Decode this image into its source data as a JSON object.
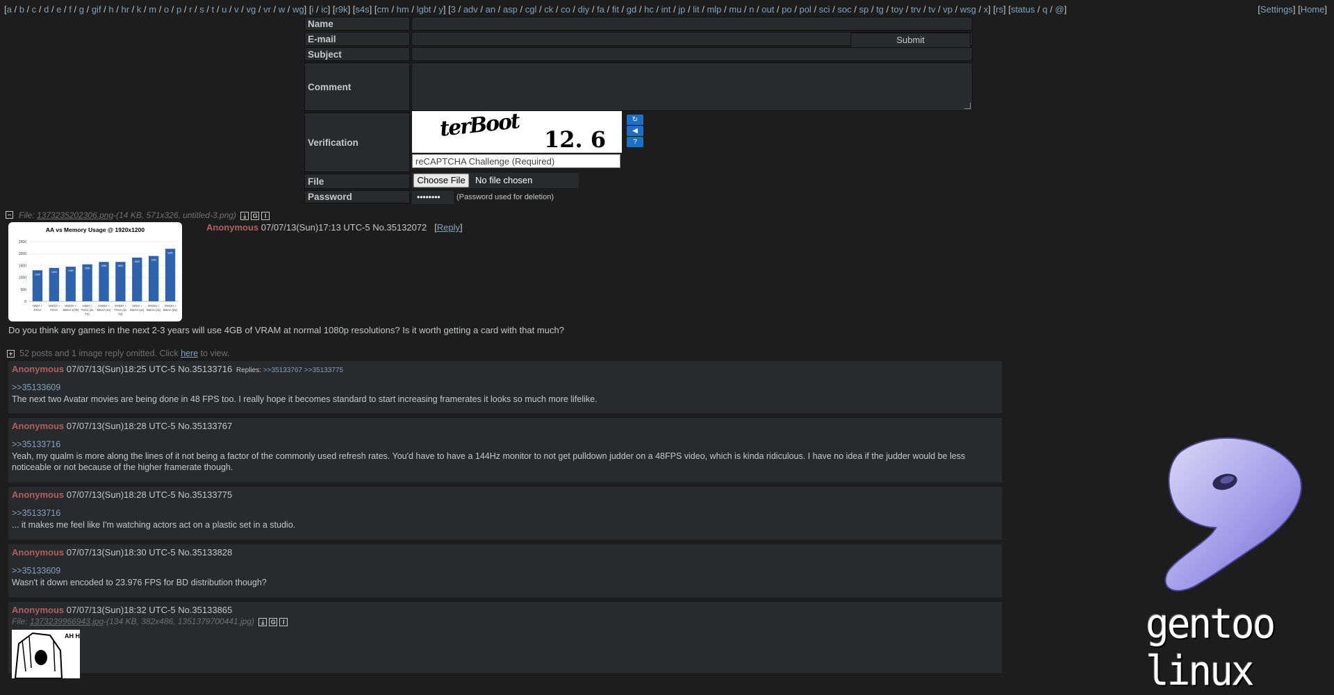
{
  "nav": {
    "group1": [
      "a",
      "b",
      "c",
      "d",
      "e",
      "f",
      "g",
      "gif",
      "h",
      "hr",
      "k",
      "m",
      "o",
      "p",
      "r",
      "s",
      "t",
      "u",
      "v",
      "vg",
      "vr",
      "w",
      "wg"
    ],
    "group2": [
      "i",
      "ic"
    ],
    "group3": [
      "r9k"
    ],
    "group4": [
      "s4s"
    ],
    "group5": [
      "cm",
      "hm",
      "lgbt",
      "y"
    ],
    "group6": [
      "3",
      "adv",
      "an",
      "asp",
      "cgl",
      "ck",
      "co",
      "diy",
      "fa",
      "fit",
      "gd",
      "hc",
      "int",
      "jp",
      "lit",
      "mlp",
      "mu",
      "n",
      "out",
      "po",
      "pol",
      "sci",
      "soc",
      "sp",
      "tg",
      "toy",
      "trv",
      "tv",
      "vp",
      "wsg",
      "x"
    ],
    "group7": [
      "rs"
    ],
    "group8": [
      "status",
      "q",
      "@"
    ],
    "settings": "Settings",
    "home": "Home"
  },
  "form": {
    "name_label": "Name",
    "email_label": "E-mail",
    "subject_label": "Subject",
    "submit_label": "Submit",
    "comment_label": "Comment",
    "verification_label": "Verification",
    "captcha_word1": "terBoot",
    "captcha_word2": "12. 6",
    "captcha_placeholder": "reCAPTCHA Challenge (Required)",
    "file_label": "File",
    "choose_file": "Choose File",
    "no_file": "No file chosen",
    "password_label": "Password",
    "password_value": "••••••••",
    "password_note": "(Password used for deletion)"
  },
  "op": {
    "file_prefix": "File: ",
    "file_name": "1373235202306.png",
    "file_meta": "-(14 KB, 571x326, untitled-3.png)",
    "name": "Anonymous",
    "datetime": "07/07/13(Sun)17:13 UTC-5",
    "post_no": "No.35132072",
    "reply_link": "Reply",
    "comment": "Do you think any games in the next 2-3 years will use 4GB of VRAM at normal 1080p resolutions? Is it worth getting a card with that much?"
  },
  "omitted": {
    "text_before": "52 posts and 1 image reply omitted. Click ",
    "link": "here",
    "text_after": " to view."
  },
  "replies": [
    {
      "name": "Anonymous",
      "datetime": "07/07/13(Sun)18:25 UTC-5",
      "no": "No.35133716",
      "replies_label": "Replies:",
      "reply_links": ">>35133767 >>35133775",
      "quote": ">>35133609",
      "text": "The next two Avatar movies are being done in 48 FPS too. I really hope it becomes standard to start increasing framerates it looks so much more lifelike."
    },
    {
      "name": "Anonymous",
      "datetime": "07/07/13(Sun)18:28 UTC-5",
      "no": "No.35133767",
      "quote": ">>35133716",
      "text": "Yeah, my qualm is more along the lines of it not being a factor of the commonly used refresh rates. You'd have to have a 144Hz monitor to not get pulldown judder on a 48FPS video, which is kinda ridiculous. I have no idea if the judder would be less noticeable or not because of the higher framerate though."
    },
    {
      "name": "Anonymous",
      "datetime": "07/07/13(Sun)18:28 UTC-5",
      "no": "No.35133775",
      "quote": ">>35133716",
      "text": "... it makes me feel like I'm watching actors act on a plastic set in a studio."
    },
    {
      "name": "Anonymous",
      "datetime": "07/07/13(Sun)18:30 UTC-5",
      "no": "No.35133828",
      "quote": ">>35133609",
      "text": "Wasn't it down encoded to 23.976 FPS for BD distribution though?"
    },
    {
      "name": "Anonymous",
      "datetime": "07/07/13(Sun)18:32 UTC-5",
      "no": "No.35133865",
      "file_prefix": "File: ",
      "file_name": "1373239966943.jpg",
      "file_meta": "-(134 KB, 382x486, 1351379700441.jpg)",
      "manga_text": "AH HA HA HA HA"
    }
  ],
  "chart_thumb": {
    "title": "AA vs Memory Usage @ 1920x1200",
    "yticks": [
      "2500",
      "2000",
      "1500",
      "1000",
      "500",
      "0"
    ],
    "categories": [
      "HIGH + FXAA",
      "VHIGH + FXAA",
      "VHIGH + SMAA 1(T6)",
      "HIGH + TXAA (2x T2)",
      "VHIGH + MSAA (2x)",
      "VHIGH + TXAA (2x T2)",
      "HIGH + MSAA (4x)",
      "VHIGH + MSAA (4x)",
      "VHIGH + MSAA (8x)"
    ],
    "values": [
      1300,
      1400,
      1450,
      1550,
      1650,
      1650,
      1830,
      1900,
      2200
    ],
    "bar_labels": [
      "1300",
      "1400",
      "1450",
      "1550",
      "1650",
      "1650",
      "1830",
      "1900",
      "2200"
    ],
    "ylim": [
      0,
      2500
    ],
    "bar_color": "#2e62ad"
  },
  "logo": {
    "text": "gentoo linux"
  },
  "colors": {
    "background": "#1d1d1d",
    "post_bg": "#282a2e",
    "name": "#b25f5f",
    "link": "#81a2be",
    "text": "#c5c8c6"
  }
}
